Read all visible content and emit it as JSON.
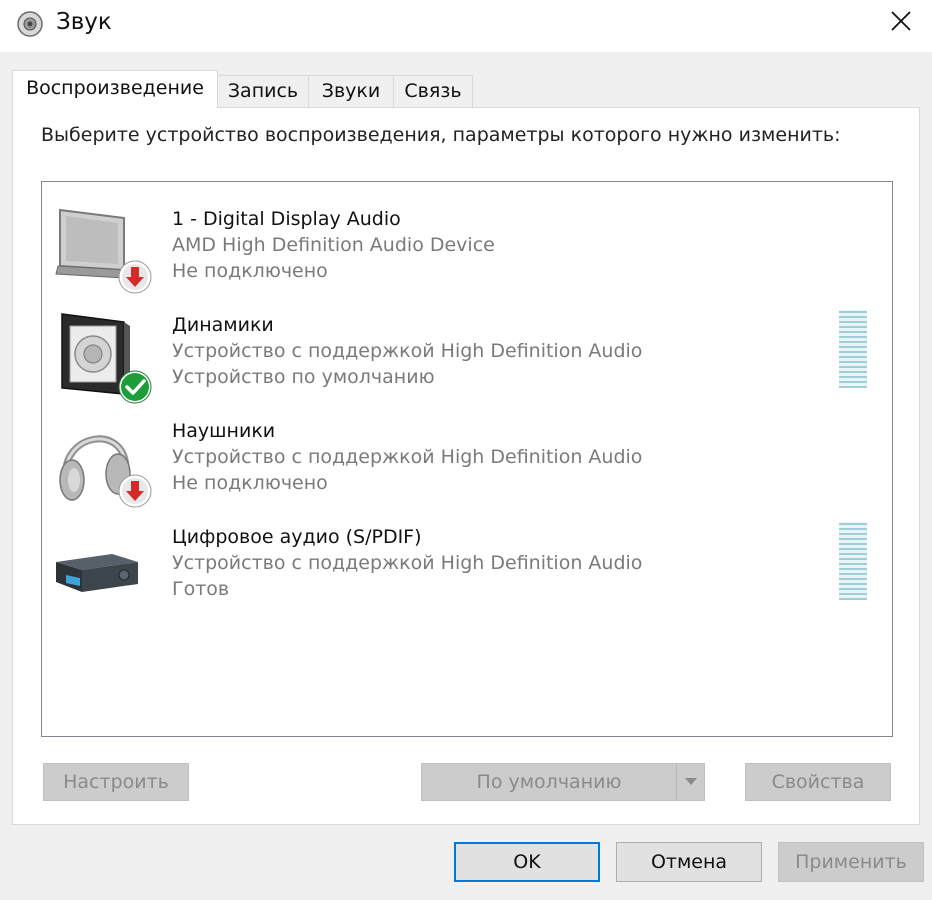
{
  "window": {
    "title": "Звук",
    "icon": "speaker-icon",
    "close_icon": "close-icon"
  },
  "tabs": [
    {
      "label": "Воспроизведение",
      "active": true
    },
    {
      "label": "Запись",
      "active": false
    },
    {
      "label": "Звуки",
      "active": false
    },
    {
      "label": "Связь",
      "active": false
    }
  ],
  "instruction": "Выберите устройство воспроизведения, параметры которого нужно изменить:",
  "devices": [
    {
      "name": "1 - Digital Display Audio",
      "description": "AMD High Definition Audio Device",
      "status": "Не подключено",
      "icon": "monitor-icon",
      "badge": "disconnected-arrow-icon",
      "has_level_meter": false
    },
    {
      "name": "Динамики",
      "description": "Устройство с поддержкой High Definition Audio",
      "status": "Устройство по умолчанию",
      "icon": "speaker-device-icon",
      "badge": "default-check-icon",
      "has_level_meter": true
    },
    {
      "name": "Наушники",
      "description": "Устройство с поддержкой High Definition Audio",
      "status": "Не подключено",
      "icon": "headphones-icon",
      "badge": "disconnected-arrow-icon",
      "has_level_meter": false
    },
    {
      "name": "Цифровое аудио (S/PDIF)",
      "description": "Устройство с поддержкой High Definition Audio",
      "status": "Готов",
      "icon": "spdif-receiver-icon",
      "badge": "",
      "has_level_meter": true
    }
  ],
  "buttons": {
    "configure": "Настроить",
    "set_default": "По умолчанию",
    "properties": "Свойства",
    "ok": "OK",
    "cancel": "Отмена",
    "apply": "Применить"
  },
  "colors": {
    "accent_focus": "#0078d7",
    "badge_red": "#d42a2a",
    "badge_green": "#1e9e3b",
    "disabled_button": "#cccccc",
    "level_meter": "#9ecfd9"
  }
}
